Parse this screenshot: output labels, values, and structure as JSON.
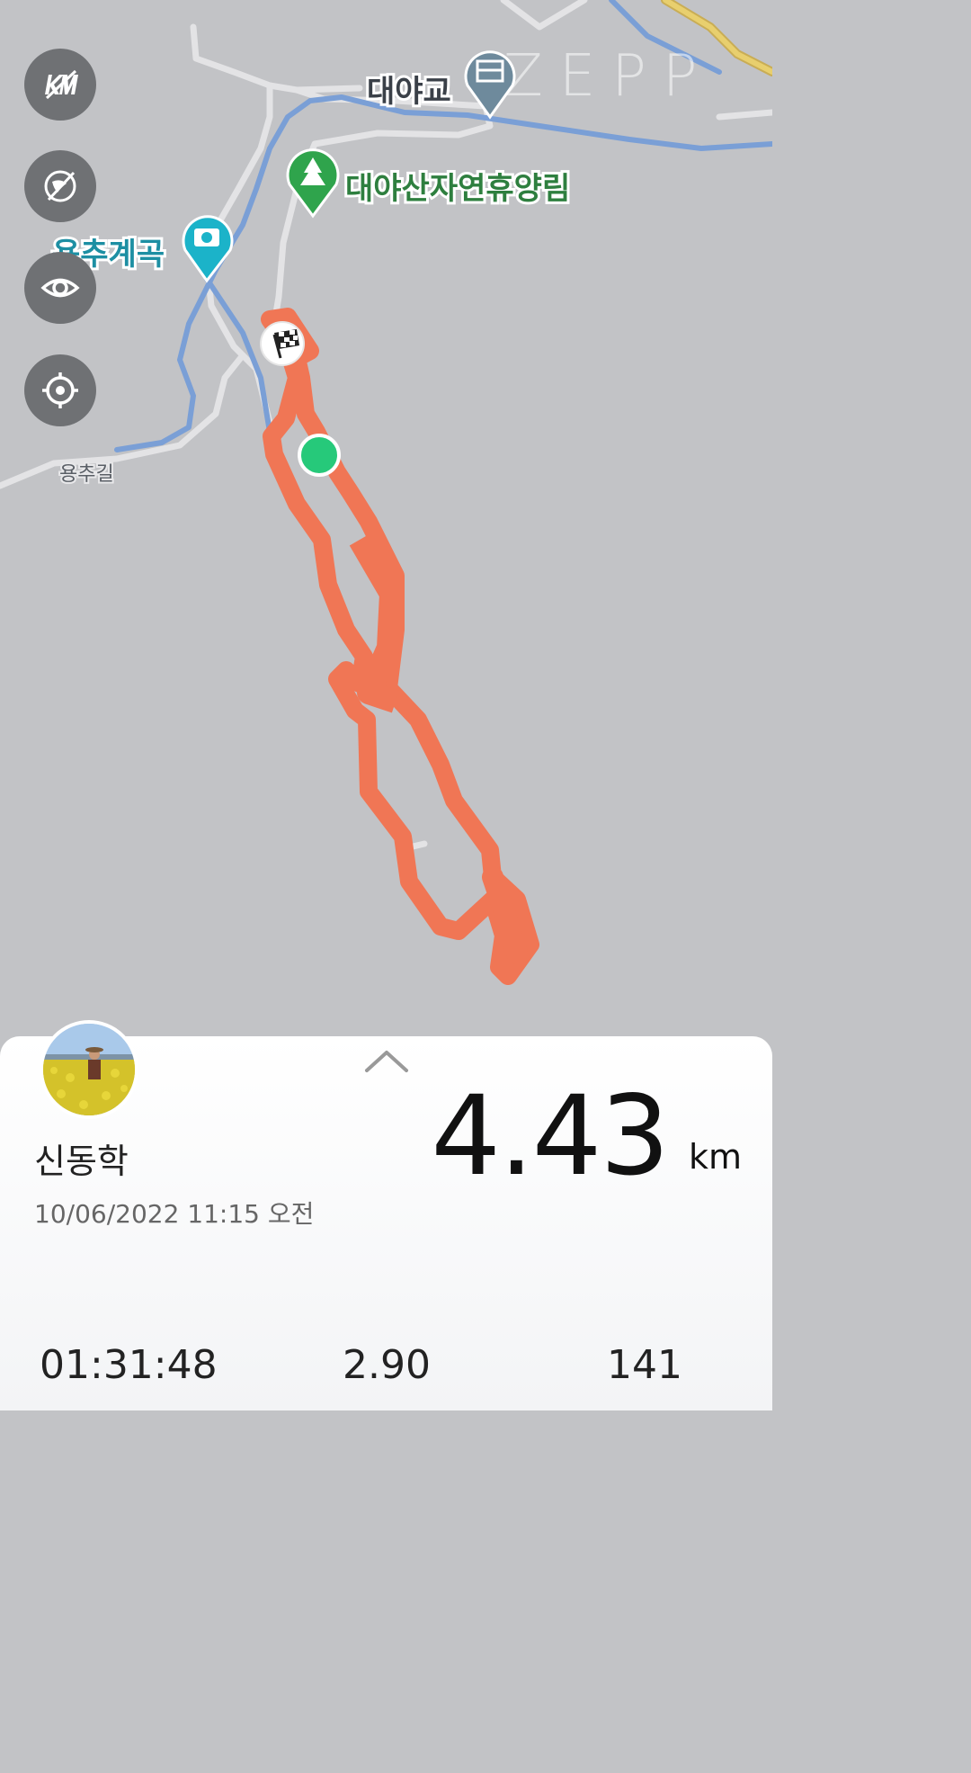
{
  "map": {
    "watermark": "ZEPP",
    "pois": {
      "bridge": "대야교",
      "forest": "대야산자연휴양림",
      "valley": "용추계곡"
    },
    "road": "용추길"
  },
  "controls": [
    {
      "icon": "km-marker-icon"
    },
    {
      "icon": "privacy-off-icon"
    },
    {
      "icon": "eye-icon"
    },
    {
      "icon": "locate-icon"
    }
  ],
  "colors": {
    "route": "#f07655",
    "start": "#26c97a",
    "map_bg": "#c2c3c6",
    "water": "#7a9fd6"
  },
  "summary": {
    "user_name": "신동학",
    "datetime": "10/06/2022 11:15 오전",
    "distance": "4.43",
    "distance_unit": "km",
    "duration": "01:31:48",
    "stat2": "2.90",
    "stat3": "141"
  }
}
